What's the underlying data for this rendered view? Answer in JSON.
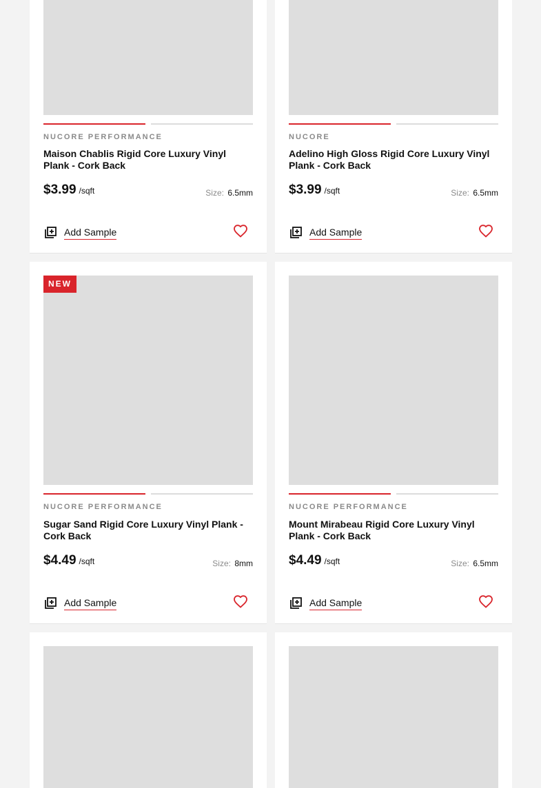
{
  "products": [
    {
      "brand": "NUCORE PERFORMANCE",
      "title": "Maison Chablis Rigid Core Luxury Vinyl Plank - Cork Back",
      "price": "$3.99",
      "unit": "/sqft",
      "size_label": "Size:",
      "size": "6.5mm",
      "badge": "",
      "sample": "Add Sample"
    },
    {
      "brand": "NUCORE",
      "title": "Adelino High Gloss Rigid Core Luxury Vinyl Plank - Cork Back",
      "price": "$3.99",
      "unit": "/sqft",
      "size_label": "Size:",
      "size": "6.5mm",
      "badge": "",
      "sample": "Add Sample"
    },
    {
      "brand": "NUCORE PERFORMANCE",
      "title": "Sugar Sand Rigid Core Luxury Vinyl Plank - Cork Back",
      "price": "$4.49",
      "unit": "/sqft",
      "size_label": "Size:",
      "size": "8mm",
      "badge": "NEW",
      "sample": "Add Sample"
    },
    {
      "brand": "NUCORE PERFORMANCE",
      "title": "Mount Mirabeau Rigid Core Luxury Vinyl Plank - Cork Back",
      "price": "$4.49",
      "unit": "/sqft",
      "size_label": "Size:",
      "size": "6.5mm",
      "badge": "",
      "sample": "Add Sample"
    }
  ],
  "icons": {
    "sample": "add-sample-icon",
    "favorite": "heart-outline-icon"
  },
  "colors": {
    "accent": "#d9242b",
    "image_placeholder": "#dedede",
    "muted": "#8a8a8a"
  }
}
